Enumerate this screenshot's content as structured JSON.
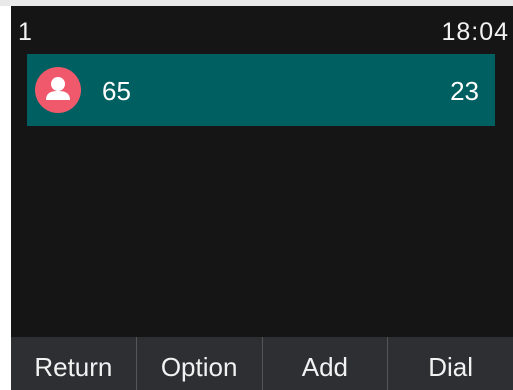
{
  "status_bar": {
    "account_index": "1",
    "time": "18:04"
  },
  "list": {
    "items": [
      {
        "icon": "contact-avatar-icon",
        "name": "65",
        "number": "23"
      }
    ]
  },
  "softkeys": [
    {
      "label": "Return"
    },
    {
      "label": "Option"
    },
    {
      "label": "Add"
    },
    {
      "label": "Dial"
    }
  ],
  "colors": {
    "screen_background": "#151515",
    "selection_highlight": "#005f60",
    "avatar": "#f0596b",
    "softkey_bar": "#2e2f33"
  }
}
